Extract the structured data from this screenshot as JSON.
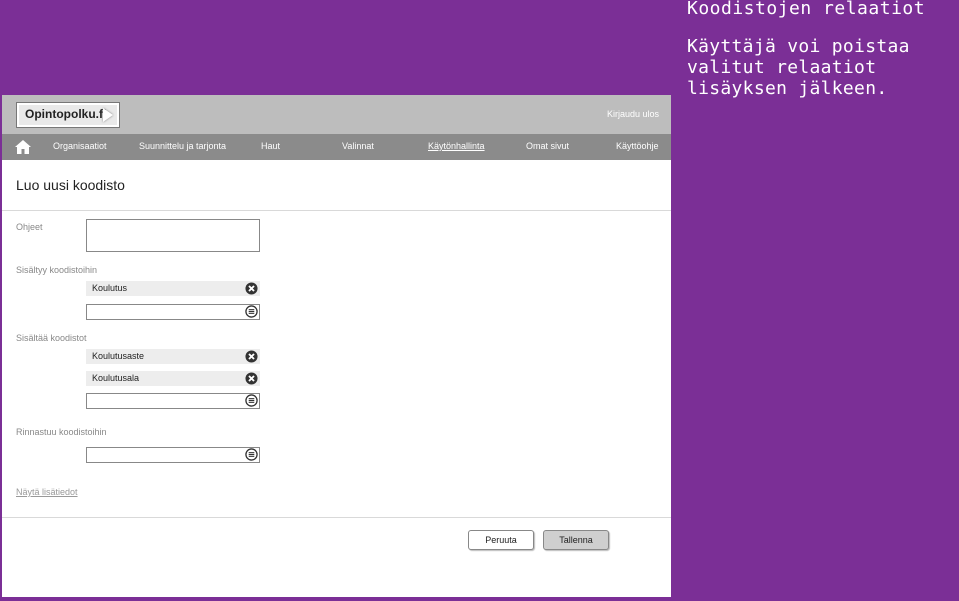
{
  "note": {
    "title": "Koodistojen relaatiot",
    "body": "Käyttäjä voi poistaa valitut relaatiot lisäyksen jälkeen."
  },
  "header": {
    "logo": "Opintopolku.fi",
    "logout": "Kirjaudu ulos"
  },
  "nav": {
    "items": [
      {
        "label": "Organisaatiot"
      },
      {
        "label": "Suunnittelu ja tarjonta"
      },
      {
        "label": "Haut"
      },
      {
        "label": "Valinnat"
      },
      {
        "label": "Käytönhallinta"
      },
      {
        "label": "Omat sivut"
      },
      {
        "label": "Käyttöohje"
      }
    ]
  },
  "page": {
    "title": "Luo uusi koodisto"
  },
  "form": {
    "ohjeet_label": "Ohjeet",
    "ohjeet_value": "",
    "included_in_label": "Sisältyy koodistoihin",
    "included_in": [
      "Koulutus"
    ],
    "includes_label": "Sisältää koodistot",
    "includes": [
      "Koulutusaste",
      "Koulutusala"
    ],
    "parallel_label": "Rinnastuu koodistoihin",
    "more_link": "Näytä lisätiedot"
  },
  "actions": {
    "cancel": "Peruuta",
    "save": "Tallenna"
  }
}
